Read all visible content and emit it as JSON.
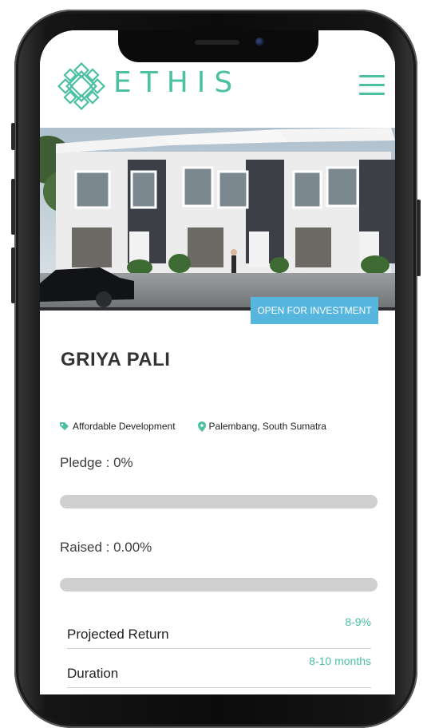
{
  "app": {
    "brand": "ETHIS",
    "menu_icon": "hamburger-menu-icon"
  },
  "project": {
    "status_badge": "OPEN FOR INVESTMENT",
    "name": "GRIYA PALI",
    "category": "Affordable Development",
    "location": "Palembang, South Sumatra",
    "pledge_label": "Pledge : 0%",
    "pledge_percent": 0,
    "raised_label": "Raised : 0.00%",
    "raised_percent": 0,
    "details": [
      {
        "label": "Projected Return",
        "value": "8-9%"
      },
      {
        "label": "Duration",
        "value": "8-10 months"
      }
    ]
  },
  "colors": {
    "brand_teal": "#4cc0a3",
    "badge_blue": "#56b6de",
    "progress_track": "#cfcfcf"
  }
}
